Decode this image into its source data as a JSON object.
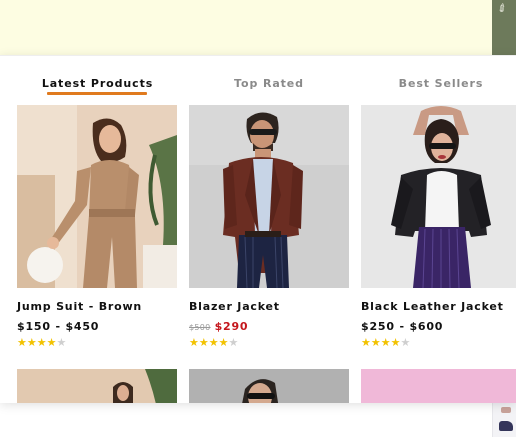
{
  "tabs": [
    {
      "label": "Latest Products",
      "active": true
    },
    {
      "label": "Top Rated",
      "active": false
    },
    {
      "label": "Best Sellers",
      "active": false
    }
  ],
  "products": [
    {
      "name": "Jump Suit - Brown",
      "price": "$150 - $450",
      "old_price": "",
      "sale_price": "",
      "rating": 4,
      "max_rating": 5
    },
    {
      "name": "Blazer Jacket",
      "price": "",
      "old_price": "$500",
      "sale_price": "$290",
      "rating": 4,
      "max_rating": 5
    },
    {
      "name": "Black Leather Jacket",
      "price": "$250 - $600",
      "old_price": "",
      "sale_price": "",
      "rating": 4,
      "max_rating": 5
    }
  ],
  "colors": {
    "accent": "#e07a1e",
    "sale": "#c4161c",
    "star": "#f2c200",
    "star_empty": "#cfcfcf",
    "hero_bg": "#fdfde2"
  }
}
